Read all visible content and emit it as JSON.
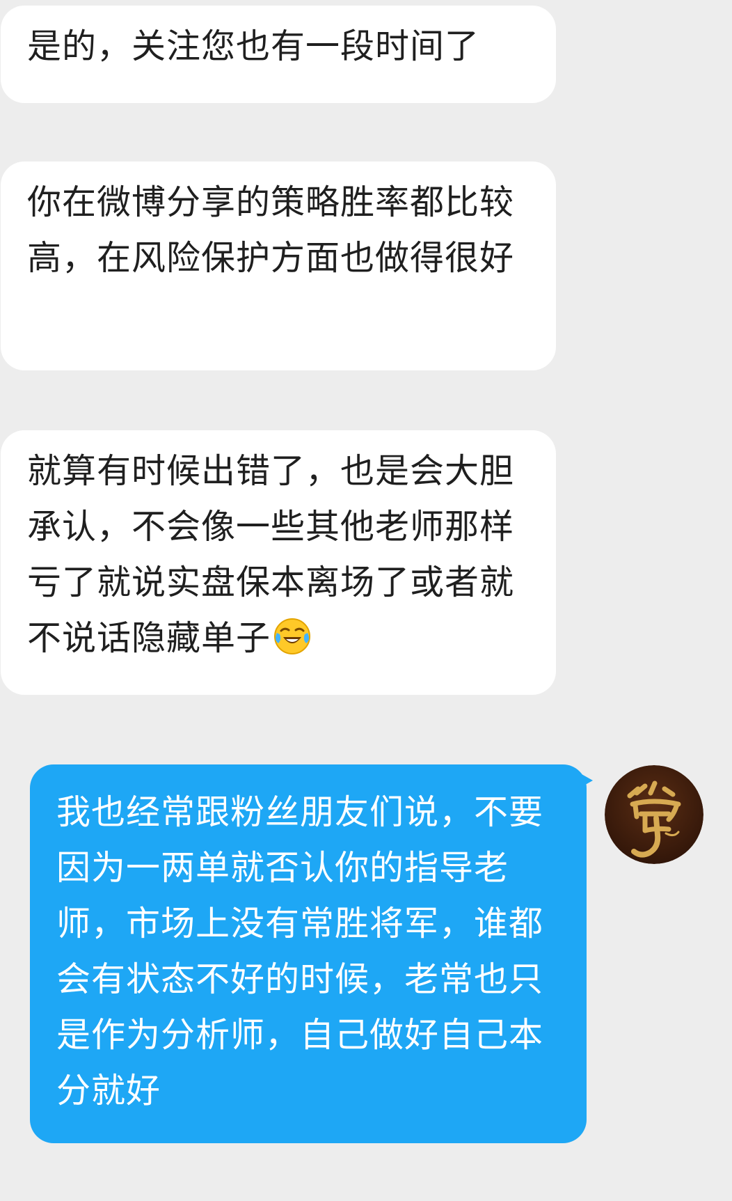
{
  "conversation": {
    "incoming": [
      {
        "text": "是的，关注您也有一段时间了"
      },
      {
        "text": "你在微博分享的策略胜率都比较高，在风险保护方面也做得很好"
      },
      {
        "text": "就算有时候出错了，也是会大胆承认，不会像一些其他老师那样亏了就说实盘保本离场了或者就不说话隐藏单子",
        "emoji": "crying-laughing-emoji"
      }
    ],
    "outgoing": [
      {
        "text": "我也经常跟粉丝朋友们说，不要因为一两单就否认你的指导老师，市场上没有常胜将军，谁都会有状态不好的时候，老常也只是作为分析师，自己做好自己本分就好"
      }
    ],
    "avatar": {
      "icon": "calligraphy-avatar",
      "glyph": "常",
      "colors": {
        "bg": "#3a1c0c",
        "ink": "#d7aa52"
      }
    }
  },
  "theme": {
    "background": "#ededed",
    "incoming_bubble": "#ffffff",
    "outgoing_bubble": "#1ea7f5",
    "incoming_text": "#1f1f1f",
    "outgoing_text": "#ffffff"
  },
  "watermark": {
    "text": ""
  }
}
